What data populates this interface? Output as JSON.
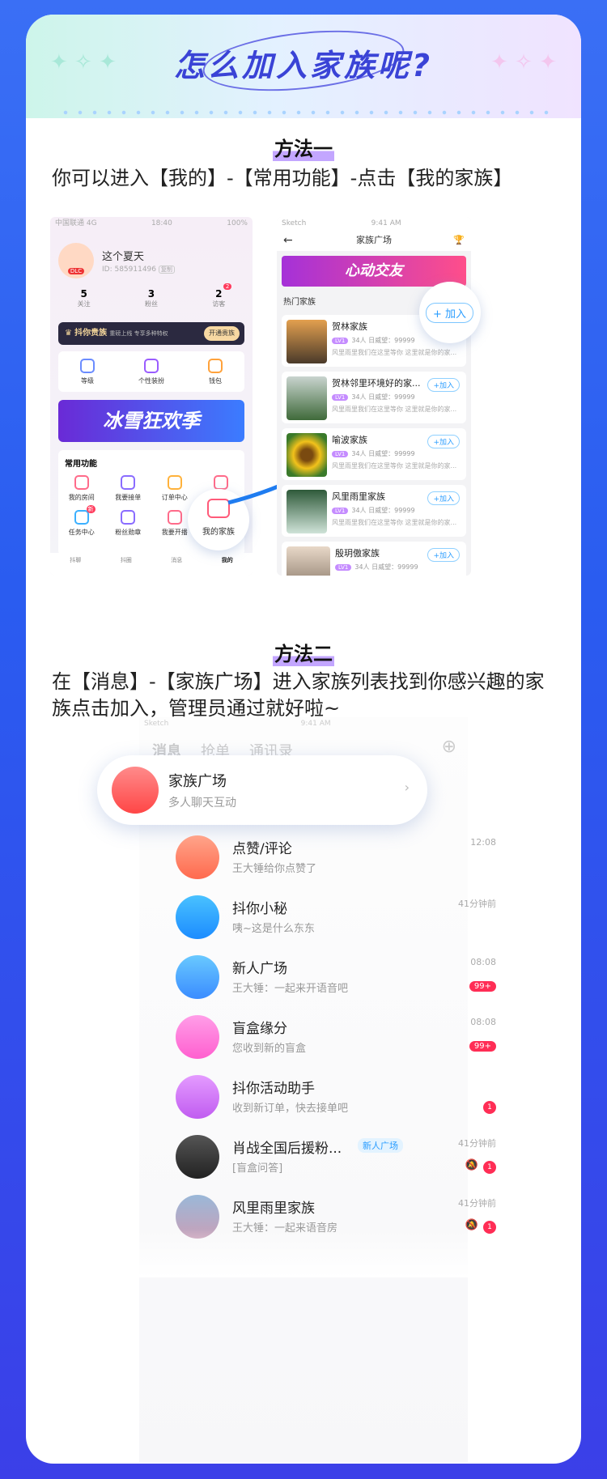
{
  "header": {
    "title": "怎么加入家族呢?"
  },
  "method1": {
    "title": "方法一",
    "desc": "你可以进入【我的】-【常用功能】-点击【我的家族】"
  },
  "method2": {
    "title": "方法二",
    "desc": "在【消息】-【家族广场】进入家族列表找到你感兴趣的家族点击加入，管理员通过就好啦~"
  },
  "me": {
    "status_carrier": "中国联通 4G",
    "status_time": "18:40",
    "status_battery": "100%",
    "username": "这个夏天",
    "user_id": "ID: 585911496",
    "copy": "复制",
    "avatar_text": "DLC",
    "stats": [
      {
        "value": "5",
        "label": "关注"
      },
      {
        "value": "3",
        "label": "粉丝"
      },
      {
        "value": "2",
        "label": "访客",
        "badge": "2"
      }
    ],
    "vip_title": "抖你贵族",
    "vip_sub": "重磅上线 专享多种特权",
    "vip_btn": "开通贵族",
    "quick": [
      "等级",
      "个性装扮",
      "钱包"
    ],
    "banner": "冰雪狂欢季",
    "common_title": "常用功能",
    "functions": [
      "我的房间",
      "我要接单",
      "订单中心",
      "",
      "任务中心",
      "粉丝勋章",
      "我要开播"
    ],
    "new_badge": "新",
    "my_family": "我的家族",
    "tabs": [
      "抖聊",
      "抖圈",
      "消息",
      "我的"
    ],
    "accent": "#ff5a79"
  },
  "plaza": {
    "status_carrier": "Sketch",
    "status_time": "9:41 AM",
    "title": "家族广场",
    "banner": "心动交友",
    "hot": "热门家族",
    "join_big": "+ 加入",
    "families": [
      {
        "name": "贺林家族",
        "count": "34人",
        "prestige": "日威望：99999",
        "desc": "风里雨里我们在这里等你 这里就是你的家...",
        "join": "+加入"
      },
      {
        "name": "贺林邻里环境好的家...",
        "count": "34人",
        "prestige": "日威望：99999",
        "desc": "风里雨里我们在这里等你 这里就是你的家...",
        "join": "+加入"
      },
      {
        "name": "喻波家族",
        "count": "34人",
        "prestige": "日威望：99999",
        "desc": "风里雨里我们在这里等你 这里就是你的家...",
        "join": "+加入"
      },
      {
        "name": "风里雨里家族",
        "count": "34人",
        "prestige": "日威望：99999",
        "desc": "风里雨里我们在这里等你 这里就是你的家...",
        "join": "+加入"
      },
      {
        "name": "殷玥傲家族",
        "count": "34人",
        "prestige": "日威望：99999",
        "desc": "",
        "join": "+加入"
      }
    ],
    "level": "LV1"
  },
  "messages": {
    "status_carrier": "Sketch",
    "status_time": "9:41 AM",
    "tabs": [
      "消息",
      "抢单",
      "通讯录"
    ],
    "plaza_title": "家族广场",
    "plaza_sub": "多人聊天互动",
    "items": [
      {
        "name": "点赞/评论",
        "sub": "王大锤给你点赞了",
        "time": "12:08",
        "badge": ""
      },
      {
        "name": "抖你小秘",
        "sub": "咦~这是什么东东",
        "time": "41分钟前",
        "badge": ""
      },
      {
        "name": "新人广场",
        "sub": "王大锤：一起来开语音吧",
        "time": "08:08",
        "badge": "99+"
      },
      {
        "name": "盲盒缘分",
        "sub": "您收到新的盲盒",
        "time": "08:08",
        "badge": "99+"
      },
      {
        "name": "抖你活动助手",
        "sub": "收到新订单，快去接单吧",
        "time": "",
        "badge": "1"
      },
      {
        "name": "肖战全国后援粉...",
        "sub": "[盲盒问答]",
        "time": "41分钟前",
        "badge": "1",
        "tag": "新人广场"
      },
      {
        "name": "风里雨里家族",
        "sub": "王大锤：一起来语音房",
        "time": "41分钟前",
        "badge": "1"
      }
    ]
  }
}
